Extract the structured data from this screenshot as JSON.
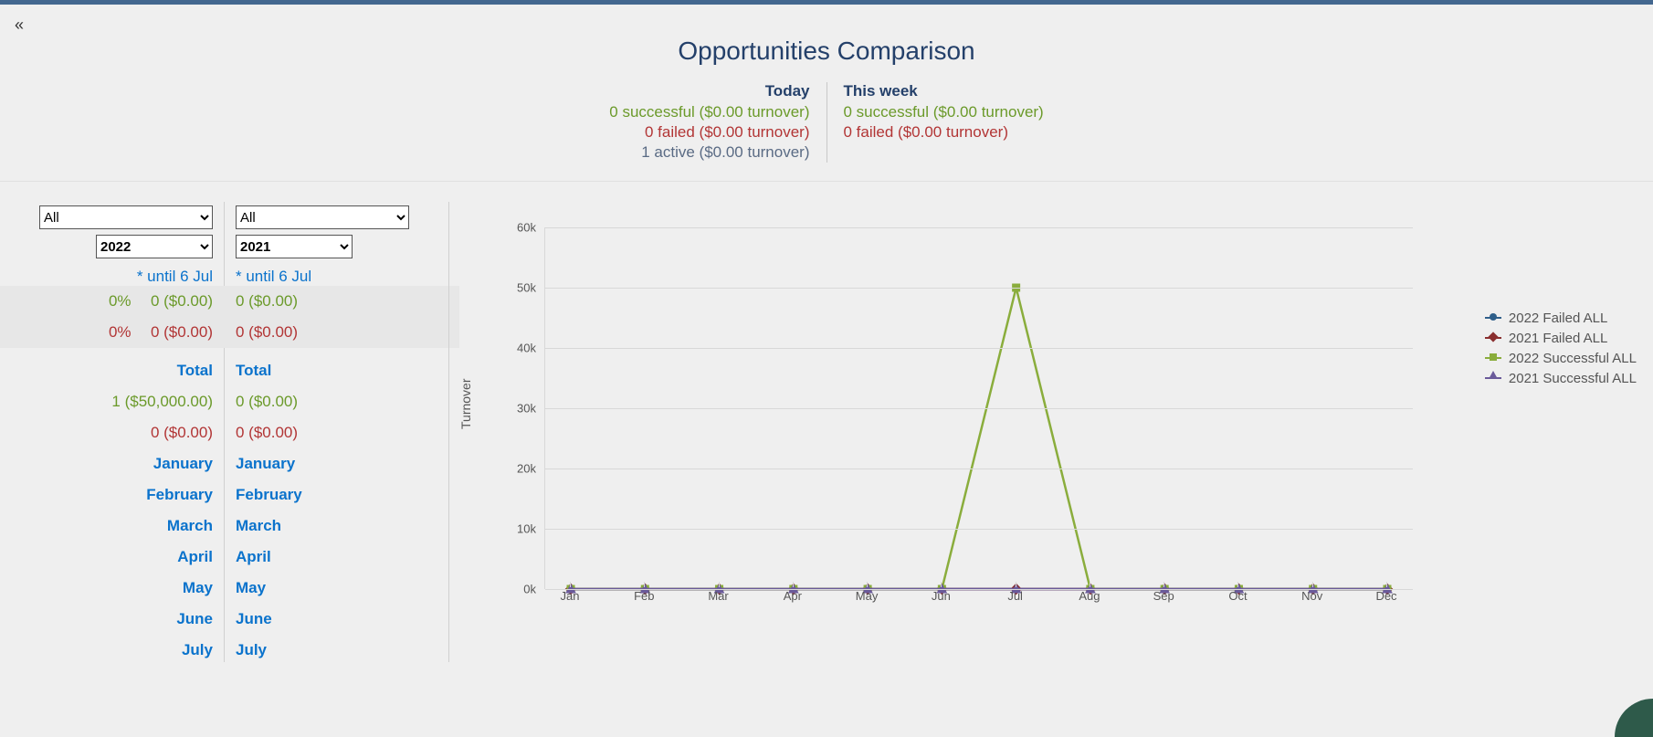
{
  "title": "Opportunities Comparison",
  "kpi": {
    "left": {
      "heading": "Today",
      "successful": "0 successful ($0.00 turnover)",
      "failed": "0 failed ($0.00 turnover)",
      "active": "1 active ($0.00 turnover)"
    },
    "right": {
      "heading": "This week",
      "successful": "0 successful ($0.00 turnover)",
      "failed": "0 failed ($0.00 turnover)"
    }
  },
  "side": {
    "colA": {
      "filter": "All",
      "year": "2022",
      "until": "* until 6 Jul",
      "row_success_pct": "0%",
      "row_success_val": "0 ($0.00)",
      "row_fail_pct": "0%",
      "row_fail_val": "0 ($0.00)",
      "total_label": "Total",
      "total_success": "1 ($50,000.00)",
      "total_fail": "0 ($0.00)",
      "months": [
        "January",
        "February",
        "March",
        "April",
        "May",
        "June",
        "July"
      ]
    },
    "colB": {
      "filter": "All",
      "year": "2021",
      "until": "* until 6 Jul",
      "row_success_val": "0 ($0.00)",
      "row_fail_val": "0 ($0.00)",
      "total_label": "Total",
      "total_success": "0 ($0.00)",
      "total_fail": "0 ($0.00)",
      "months": [
        "January",
        "February",
        "March",
        "April",
        "May",
        "June",
        "July"
      ]
    }
  },
  "chart_data": {
    "type": "line",
    "xlabel": "",
    "ylabel": "Turnover",
    "ylim": [
      0,
      60000
    ],
    "yticks": [
      0,
      10000,
      20000,
      30000,
      40000,
      50000,
      60000
    ],
    "ytick_labels": [
      "0k",
      "10k",
      "20k",
      "30k",
      "40k",
      "50k",
      "60k"
    ],
    "categories": [
      "Jan",
      "Feb",
      "Mar",
      "Apr",
      "May",
      "Jun",
      "Jul",
      "Aug",
      "Sep",
      "Oct",
      "Nov",
      "Dec"
    ],
    "series": [
      {
        "name": "2022 Failed ALL",
        "color": "#2f5f8a",
        "marker": "circle",
        "values": [
          0,
          0,
          0,
          0,
          0,
          0,
          0,
          0,
          0,
          0,
          0,
          0
        ]
      },
      {
        "name": "2021 Failed ALL",
        "color": "#8a2f2f",
        "marker": "diamond",
        "values": [
          0,
          0,
          0,
          0,
          0,
          0,
          0,
          0,
          0,
          0,
          0,
          0
        ]
      },
      {
        "name": "2022 Successful ALL",
        "color": "#8aad3c",
        "marker": "square",
        "values": [
          0,
          0,
          0,
          0,
          0,
          0,
          50000,
          0,
          0,
          0,
          0,
          0
        ]
      },
      {
        "name": "2021 Successful ALL",
        "color": "#6a5a9a",
        "marker": "tri",
        "values": [
          0,
          0,
          0,
          0,
          0,
          0,
          0,
          0,
          0,
          0,
          0,
          0
        ]
      }
    ]
  }
}
